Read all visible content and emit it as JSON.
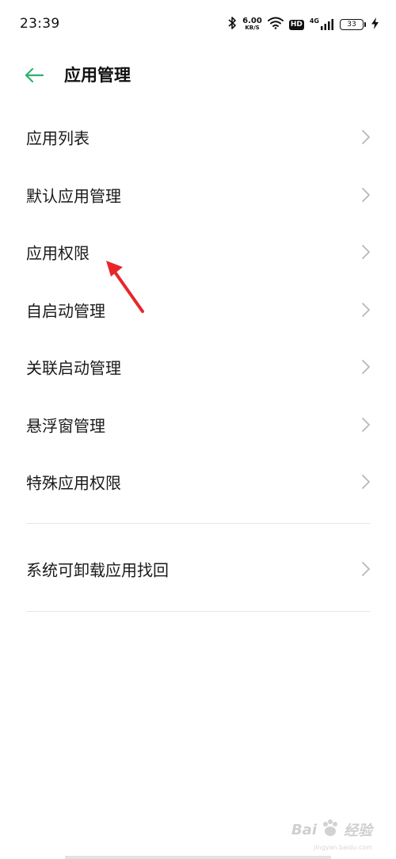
{
  "status_bar": {
    "time": "23:39",
    "speed_value": "6.00",
    "speed_unit": "KB/S",
    "hd_label": "HD",
    "network_label": "4G",
    "battery_level": "33"
  },
  "header": {
    "title": "应用管理"
  },
  "menu": {
    "items": [
      {
        "label": "应用列表"
      },
      {
        "label": "默认应用管理"
      },
      {
        "label": "应用权限"
      },
      {
        "label": "自启动管理"
      },
      {
        "label": "关联启动管理"
      },
      {
        "label": "悬浮窗管理"
      },
      {
        "label": "特殊应用权限"
      }
    ],
    "secondary_items": [
      {
        "label": "系统可卸载应用找回"
      }
    ]
  },
  "watermark": {
    "text": "Bai",
    "text2": "经验",
    "sub": "jingyan.baidu.com"
  },
  "colors": {
    "accent": "#2bb36f",
    "arrow": "#e8262a",
    "chevron": "#b8b8b8",
    "divider": "#e6e6e6"
  },
  "icons": {
    "back": "back-arrow-icon",
    "chevron": "chevron-right-icon",
    "bluetooth": "bluetooth-icon",
    "wifi": "wifi-icon",
    "signal": "signal-bars-icon",
    "battery": "battery-icon",
    "charging": "charging-bolt-icon"
  }
}
